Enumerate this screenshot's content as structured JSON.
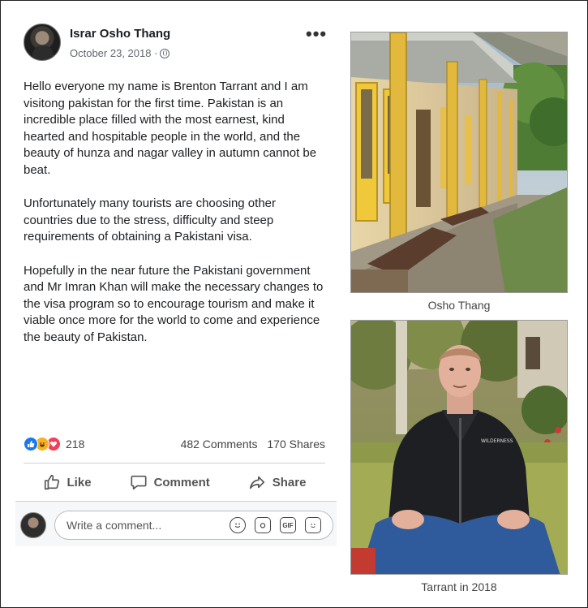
{
  "post": {
    "author": "Israr Osho Thang",
    "date": "October 23, 2018 ·",
    "more": "•••",
    "paragraphs": [
      "Hello everyone my name is Brenton Tarrant and I am visitong pakistan for the first time. Pakistan is an incredible place filled with the most earnest, kind hearted and hospitable people in the world, and the beauty of hunza and nagar valley in autumn cannot be beat.",
      "Unfortunately many tourists are choosing other countries due to the stress, difficulty and steep requirements of obtaining a Pakistani visa.",
      "Hopefully in the near future the Pakistani government and Mr Imran Khan will make the necessary changes to the visa program so to encourage tourism and make it viable once more for the world to come and experience the beauty of Pakistan."
    ],
    "reactions": {
      "count": "218",
      "icons": [
        "like-reaction-icon",
        "haha-reaction-icon",
        "love-reaction-icon"
      ],
      "colors": {
        "like": "#1877f2",
        "haha": "#f7b125",
        "love": "#f33e58"
      }
    },
    "comments_count": "482 Comments",
    "shares_count": "170 Shares",
    "actions": {
      "like": "Like",
      "comment": "Comment",
      "share": "Share"
    },
    "comment_input": {
      "placeholder": "Write a comment...",
      "icons": [
        "emoji-icon",
        "camera-icon",
        "gif-icon",
        "sticker-icon"
      ],
      "gif_label": "GIF"
    }
  },
  "photos": [
    {
      "caption": "Osho Thang"
    },
    {
      "caption": "Tarrant in 2018"
    }
  ]
}
